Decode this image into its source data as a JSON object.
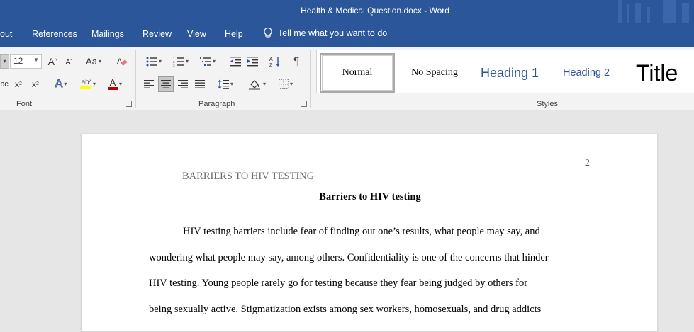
{
  "window": {
    "title": "Health & Medical Question.docx  -  Word"
  },
  "menu": {
    "tabs": [
      "out",
      "References",
      "Mailings",
      "Review",
      "View",
      "Help"
    ],
    "tell_me": "Tell me what you want to do"
  },
  "ribbon": {
    "font": {
      "size": "12",
      "change_case": "Aa",
      "label": "Font"
    },
    "paragraph": {
      "label": "Paragraph"
    },
    "styles": {
      "label": "Styles",
      "items": [
        "Normal",
        "No Spacing",
        "Heading 1",
        "Heading 2",
        "Title"
      ]
    },
    "colors": {
      "ribbon_bar": "#2b579a",
      "highlight": "#ffff00",
      "font_color": "#c00000",
      "heading_blue": "#2f5496"
    }
  },
  "document": {
    "page_number": "2",
    "running_head": "BARRIERS TO HIV TESTING",
    "title": "Barriers to HIV testing",
    "lines": [
      "HIV testing barriers include fear of finding out one’s results, what people may say, and",
      "wondering what people may say, among others. Confidentiality is one of the concerns that hinder",
      "HIV testing. Young people rarely go for testing because they fear being judged by others for",
      "being sexually active. Stigmatization exists among sex workers, homosexuals, and drug addicts"
    ]
  }
}
